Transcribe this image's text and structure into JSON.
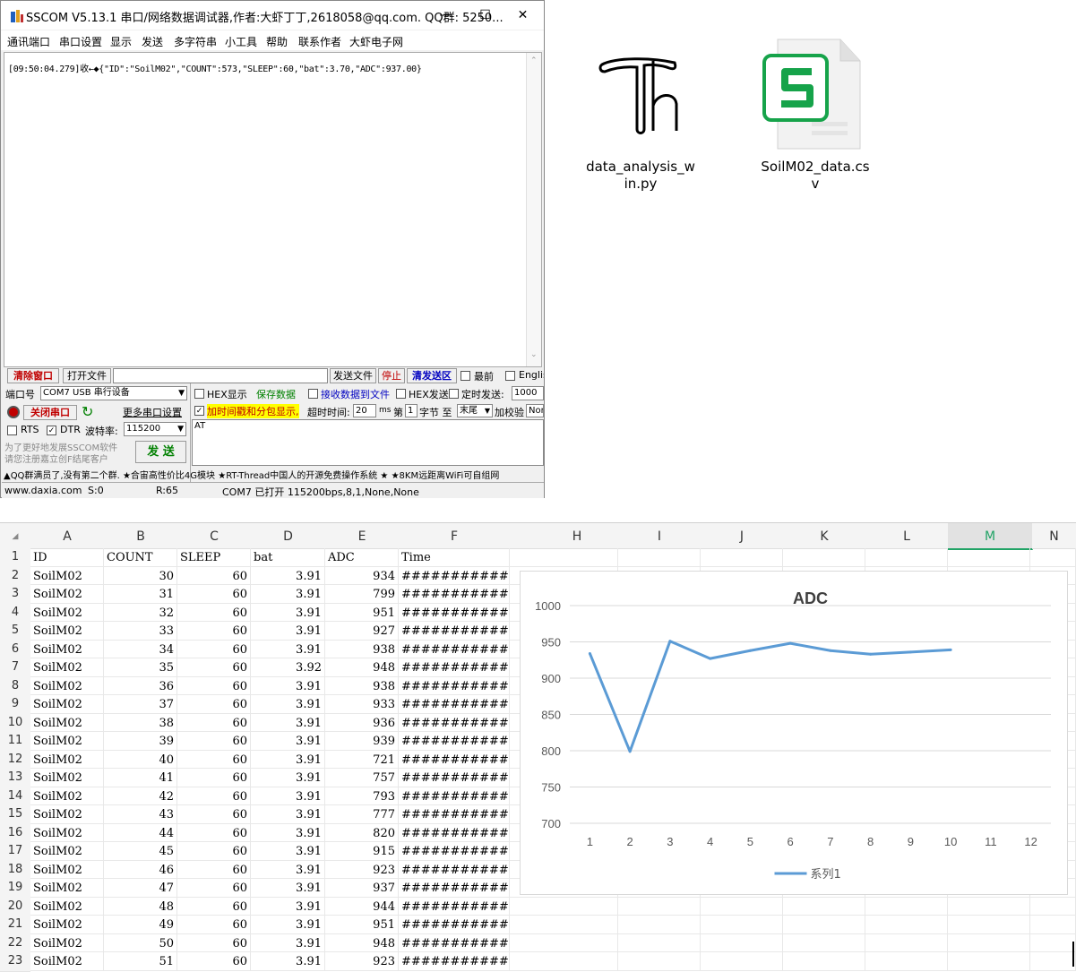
{
  "sscom": {
    "title": "SSCOM V5.13.1 串口/网络数据调试器,作者:大虾丁丁,2618058@qq.com. QQ群:  5250...",
    "win_min": "—",
    "win_max": "☐",
    "win_close": "✕",
    "menu": [
      "通讯端口",
      "串口设置",
      "显示",
      "发送",
      "多字符串",
      "小工具",
      "帮助",
      "联系作者",
      "大虾电子网"
    ],
    "received": "[09:50:04.279]收←◆{\"ID\":\"SoilM02\",\"COUNT\":573,\"SLEEP\":60,\"bat\":3.70,\"ADC\":937.00}",
    "clear_btn": "清除窗口",
    "open_file_btn": "打开文件",
    "send_file_btn": "发送文件",
    "stop_btn": "停止",
    "clear_send_btn": "清发送区",
    "topmost_label": "最前",
    "english_label": "English",
    "port_label": "端口号",
    "port_value": "COM7 USB 串行设备",
    "hex_show": "HEX显示",
    "save_data": "保存数据",
    "recv_to_file": "接收数据到文件",
    "hex_send": "HEX发送",
    "timed_send": "定时发送:",
    "timed_value": "1000",
    "close_port_btn": "关闭串口",
    "more_settings": "更多串口设置",
    "timestamp_label": "加时间戳和分包显示,",
    "timeout_label": "超时时间:",
    "timeout_value": "20",
    "ms_label": "ms",
    "page_label": "第",
    "page_value": "1",
    "byte_label": "字节 至",
    "tail_value": "末尾",
    "checksum_label": "加校验",
    "checksum_value": "None",
    "rts_label": "RTS",
    "dtr_label": "DTR",
    "baud_label": "波特率:",
    "baud_value": "115200",
    "send_text": "AT",
    "promo_line1": "为了更好地发展SSCOM软件",
    "promo_line2": "请您注册嘉立创F结尾客户",
    "send_btn": "发 送",
    "ticker": "▲QQ群满员了,没有第二个群. ★合宙高性价比4G模块 ★RT-Thread中国人的开源免费操作系统 ★ ★8KM远距离WiFi可自组网",
    "status_site": "www.daxia.com",
    "status_s": "S:0",
    "status_r": "R:65",
    "status_port": "COM7 已打开  115200bps,8,1,None,None"
  },
  "desktop": {
    "file1_line1": "data_analysis_w",
    "file1_line2": "in.py",
    "file2_line1": "SoilM02_data.cs",
    "file2_line2": "v",
    "file1_icon_glyph": "Th",
    "file2_icon_glyph": "S"
  },
  "sheet": {
    "corner": "◢",
    "columns": [
      "A",
      "B",
      "C",
      "D",
      "E",
      "F",
      "H",
      "I",
      "J",
      "K",
      "L",
      "M",
      "N"
    ],
    "headers": [
      "ID",
      "COUNT",
      "SLEEP",
      "bat",
      "ADC",
      "Time"
    ],
    "rows": [
      [
        "SoilM02",
        "30",
        "60",
        "3.91",
        "934",
        "#############"
      ],
      [
        "SoilM02",
        "31",
        "60",
        "3.91",
        "799",
        "#############"
      ],
      [
        "SoilM02",
        "32",
        "60",
        "3.91",
        "951",
        "#############"
      ],
      [
        "SoilM02",
        "33",
        "60",
        "3.91",
        "927",
        "#############"
      ],
      [
        "SoilM02",
        "34",
        "60",
        "3.91",
        "938",
        "#############"
      ],
      [
        "SoilM02",
        "35",
        "60",
        "3.92",
        "948",
        "#############"
      ],
      [
        "SoilM02",
        "36",
        "60",
        "3.91",
        "938",
        "#############"
      ],
      [
        "SoilM02",
        "37",
        "60",
        "3.91",
        "933",
        "#############"
      ],
      [
        "SoilM02",
        "38",
        "60",
        "3.91",
        "936",
        "#############"
      ],
      [
        "SoilM02",
        "39",
        "60",
        "3.91",
        "939",
        "#############"
      ],
      [
        "SoilM02",
        "40",
        "60",
        "3.91",
        "721",
        "#############"
      ],
      [
        "SoilM02",
        "41",
        "60",
        "3.91",
        "757",
        "#############"
      ],
      [
        "SoilM02",
        "42",
        "60",
        "3.91",
        "793",
        "#############"
      ],
      [
        "SoilM02",
        "43",
        "60",
        "3.91",
        "777",
        "#############"
      ],
      [
        "SoilM02",
        "44",
        "60",
        "3.91",
        "820",
        "#############"
      ],
      [
        "SoilM02",
        "45",
        "60",
        "3.91",
        "915",
        "#############"
      ],
      [
        "SoilM02",
        "46",
        "60",
        "3.91",
        "923",
        "#############"
      ],
      [
        "SoilM02",
        "47",
        "60",
        "3.91",
        "937",
        "#############"
      ],
      [
        "SoilM02",
        "48",
        "60",
        "3.91",
        "944",
        "#############"
      ],
      [
        "SoilM02",
        "49",
        "60",
        "3.91",
        "951",
        "#############"
      ],
      [
        "SoilM02",
        "50",
        "60",
        "3.91",
        "948",
        "#############"
      ],
      [
        "SoilM02",
        "51",
        "60",
        "3.91",
        "923",
        "#############"
      ]
    ],
    "row_numbers": [
      "1",
      "2",
      "3",
      "4",
      "5",
      "6",
      "7",
      "8",
      "9",
      "10",
      "11",
      "12",
      "13",
      "14",
      "15",
      "16",
      "17",
      "18",
      "19",
      "20",
      "21",
      "22",
      "23"
    ]
  },
  "chart_data": {
    "type": "line",
    "title": "ADC",
    "x": [
      "1",
      "2",
      "3",
      "4",
      "5",
      "6",
      "7",
      "8",
      "9",
      "10",
      "11",
      "12"
    ],
    "series": [
      {
        "name": "系列1",
        "values": [
          934,
          799,
          951,
          927,
          938,
          948,
          938,
          933,
          936,
          939
        ],
        "color": "#5b9bd5"
      }
    ],
    "yticks": [
      "1000",
      "950",
      "900",
      "850",
      "800",
      "750",
      "700"
    ],
    "ylim": [
      700,
      1000
    ],
    "grid": true,
    "legend": "bottom"
  },
  "colors": {
    "accent": "#5b9bd5",
    "selected_col": "#21a366",
    "red_text": "#c00000",
    "green_text": "#008000",
    "blue_text": "#0000c0",
    "highlight": "#ffff00"
  }
}
